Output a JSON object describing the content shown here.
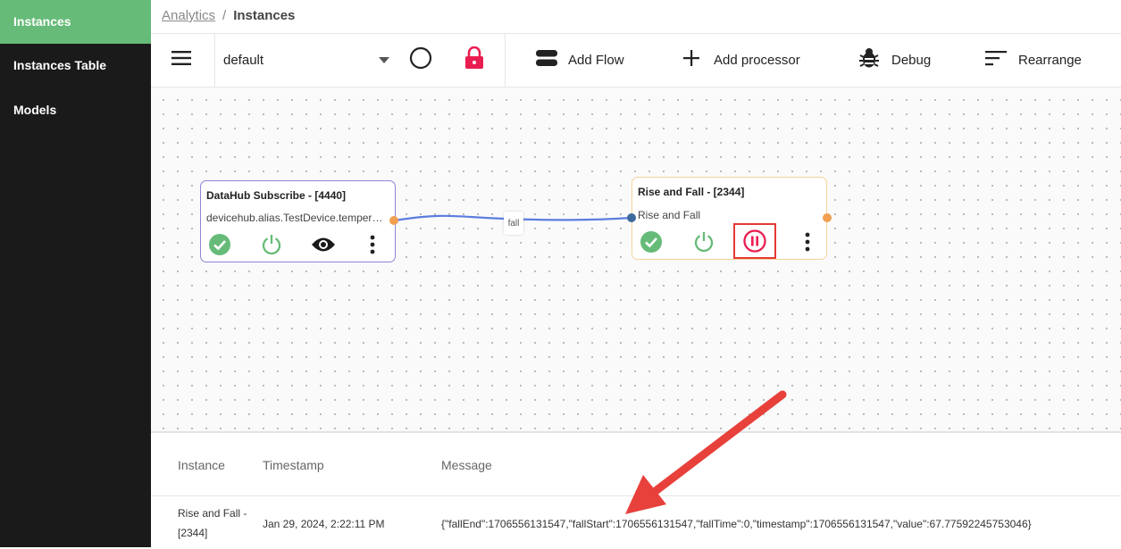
{
  "sidebar": {
    "items": [
      {
        "label": "Instances",
        "active": true
      },
      {
        "label": "Instances Table",
        "active": false
      },
      {
        "label": "Models",
        "active": false
      }
    ]
  },
  "breadcrumb": {
    "parent": "Analytics",
    "separator": "/",
    "current": "Instances"
  },
  "toolbar": {
    "menu_icon": "hamburger-menu-icon",
    "flow_select": {
      "selected": "default"
    },
    "status_icon": "circle-outline-icon",
    "lock_icon": "lock-icon",
    "add_flow": "Add Flow",
    "add_processor": "Add processor",
    "debug": "Debug",
    "rearrange": "Rearrange"
  },
  "canvas": {
    "nodes": [
      {
        "title": "DataHub Subscribe - [4440]",
        "subtitle": "devicehub.alias.TestDevice.temperature",
        "icons": [
          "check-circle-icon",
          "power-icon",
          "eye-icon",
          "more-vert-icon"
        ]
      },
      {
        "title": "Rise and Fall - [2344]",
        "subtitle": "Rise and Fall",
        "icons": [
          "check-circle-icon",
          "power-icon",
          "pause-circle-icon",
          "more-vert-icon"
        ]
      }
    ],
    "edge_label": "fall"
  },
  "log_table": {
    "columns": [
      "Instance",
      "Timestamp",
      "Message"
    ],
    "rows": [
      {
        "instance": "Rise and Fall - [2344]",
        "timestamp": "Jan 29, 2024, 2:22:11 PM",
        "message": "{\"fallEnd\":1706556131547,\"fallStart\":1706556131547,\"fallTime\":0,\"timestamp\":1706556131547,\"value\":67.77592245753046}"
      }
    ]
  },
  "colors": {
    "accent": "#66bb78",
    "sidebar_bg": "#1a1a1a",
    "danger": "#e91e50",
    "highlight_box": "#e53935",
    "edge": "#5c7de0",
    "port_out": "#f0a050",
    "node1_border": "#8b86d6",
    "node2_border": "#f3d39a",
    "arrow": "#e8403a"
  }
}
